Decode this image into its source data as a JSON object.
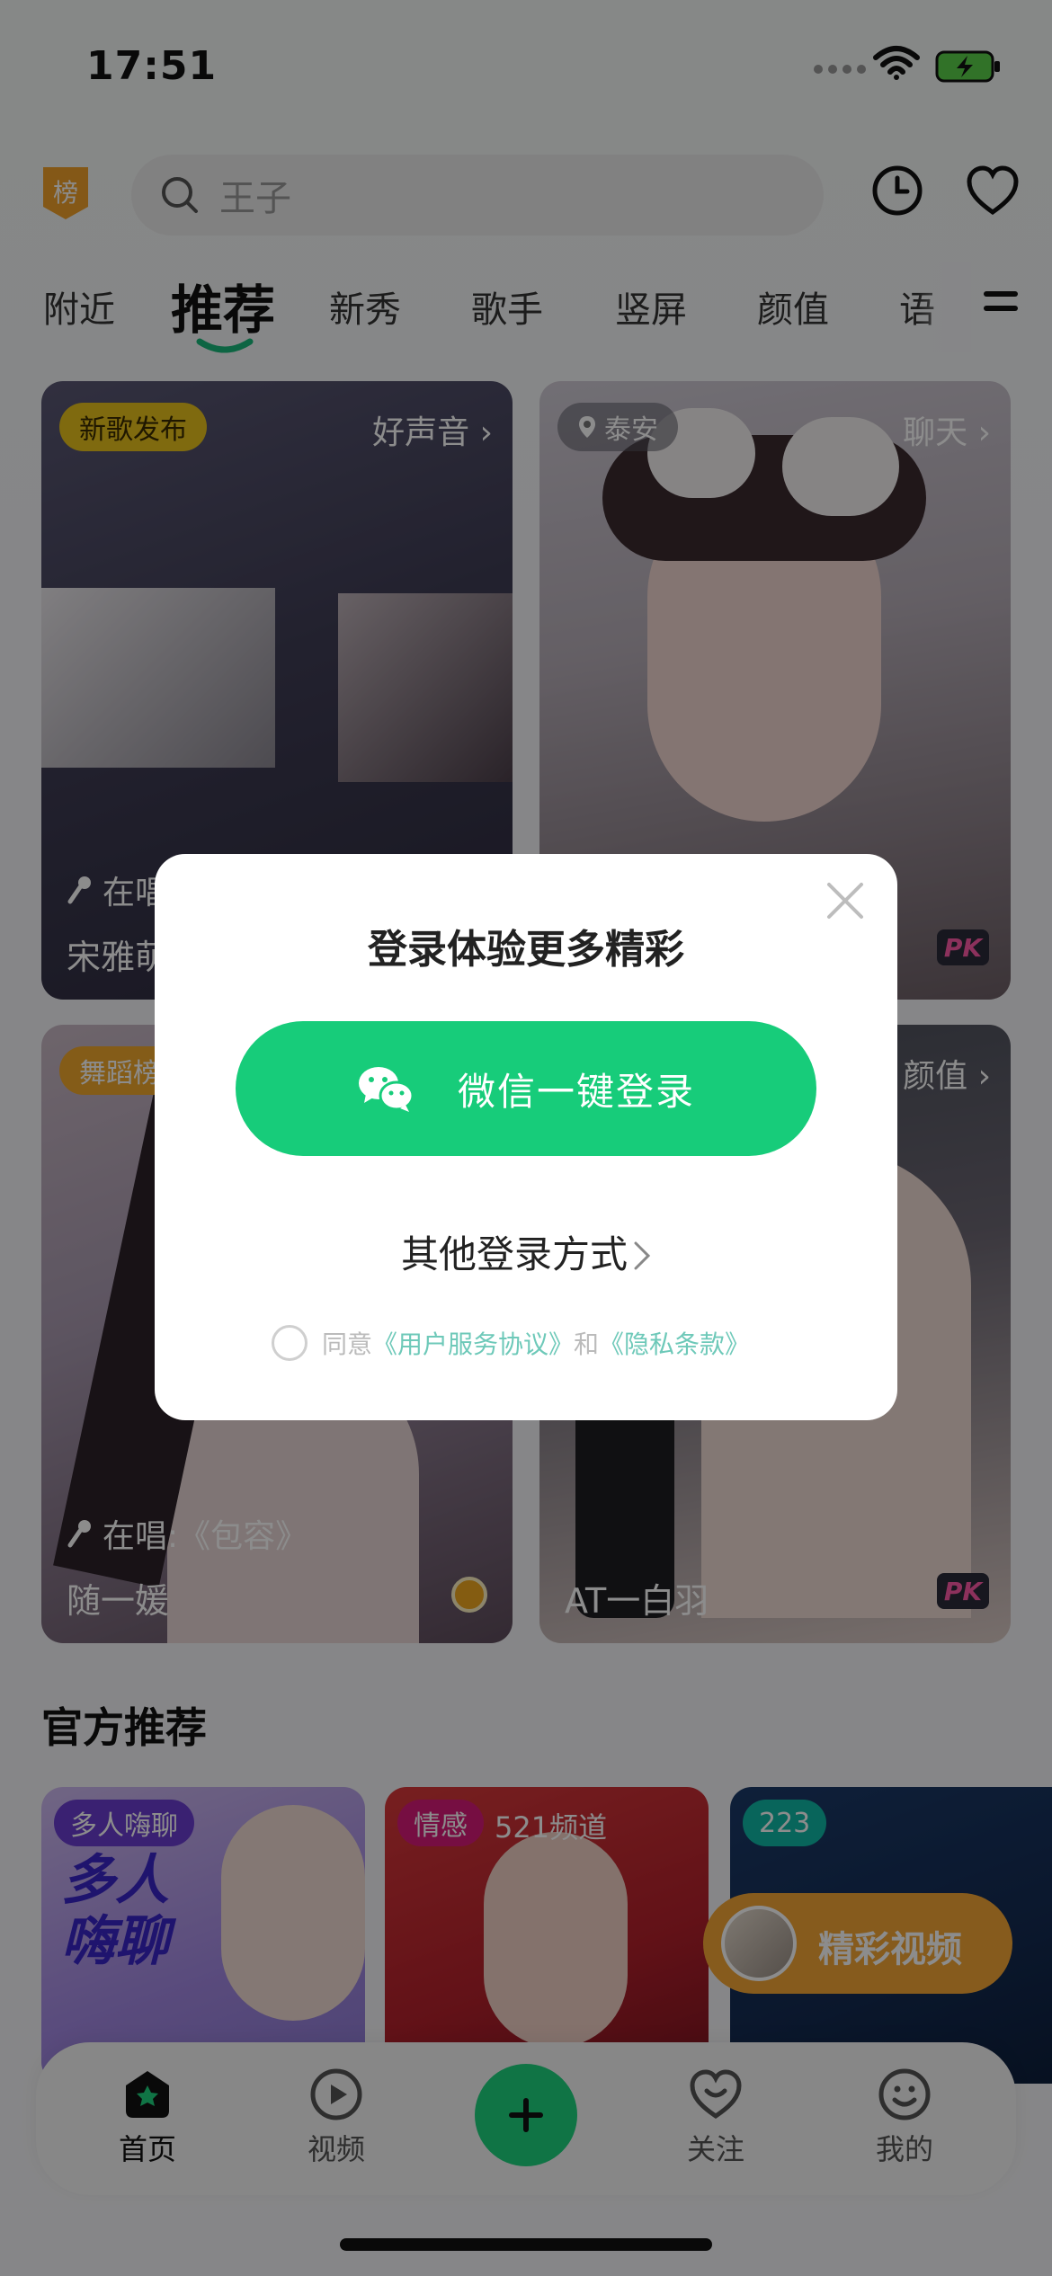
{
  "status_bar": {
    "time": "17:51"
  },
  "header": {
    "rank_badge": "榜",
    "search_placeholder": "王子"
  },
  "tabs": [
    {
      "label": "附近",
      "active": false
    },
    {
      "label": "推荐",
      "active": true
    },
    {
      "label": "新秀",
      "active": false
    },
    {
      "label": "歌手",
      "active": false
    },
    {
      "label": "竖屏",
      "active": false
    },
    {
      "label": "颜值",
      "active": false
    },
    {
      "label": "语",
      "active": false
    }
  ],
  "cards": [
    {
      "tag": "新歌发布",
      "category": "好声音 ›",
      "song": "在唱",
      "name": "宋雅萌"
    },
    {
      "tag": "泰安",
      "category": "聊天 ›",
      "badge": "PK"
    },
    {
      "tag": "舞蹈榜",
      "category": "颜值 ›",
      "song": "在唱:《包容》",
      "name": "随一媛"
    },
    {
      "name": "AT一白羽",
      "badge": "PK"
    }
  ],
  "section": {
    "title": "官方推荐"
  },
  "recommendations": [
    {
      "tag": "多人嗨聊",
      "big_text": "多人\n嗨聊"
    },
    {
      "tag": "情感",
      "subtitle": "521频道"
    },
    {
      "tag": "223"
    }
  ],
  "video_float": {
    "label": "精彩视频"
  },
  "bottom_nav": {
    "items": [
      {
        "label": "首页"
      },
      {
        "label": "视频"
      },
      {
        "label": "关注"
      },
      {
        "label": "我的"
      }
    ]
  },
  "modal": {
    "title": "登录体验更多精彩",
    "wechat_button": "微信一键登录",
    "other_login": "其他登录方式",
    "agree_prefix": "同意",
    "agree_link1": "《用户服务协议》",
    "agree_and": "和",
    "agree_link2": "《隐私条款》"
  },
  "colors": {
    "brand_green": "#17cc7a",
    "link_teal": "#6ec9b9",
    "accent_orange": "#f4a635"
  }
}
